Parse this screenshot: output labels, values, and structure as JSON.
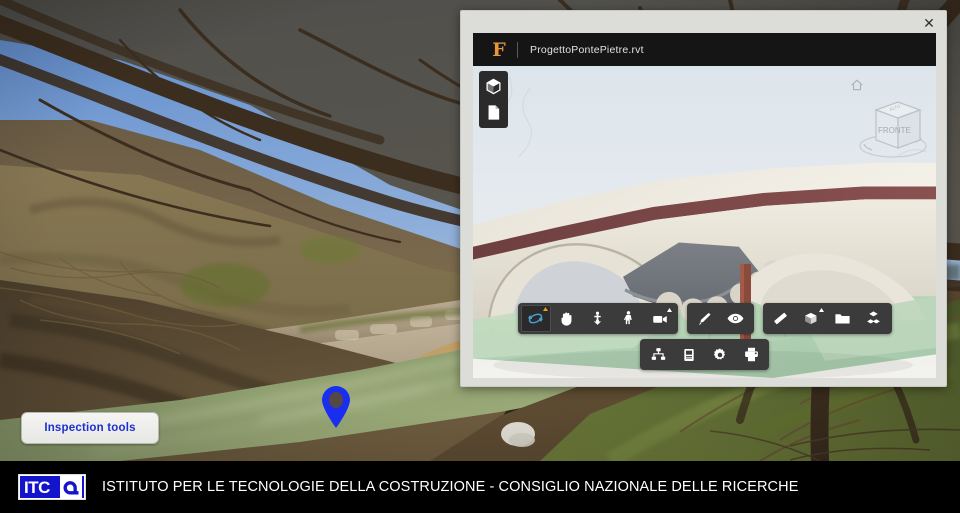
{
  "scene": {
    "description": "Photograph of a stone masonry arch bridge over a shallow green stream with bare winter tree branches",
    "marker_label": "inspection-point"
  },
  "overlay": {
    "inspection_button_label": "Inspection tools"
  },
  "viewer": {
    "close_label": "✕",
    "brand_letter": "F",
    "filename": "ProgettoPontePietre.rvt",
    "left_tools": [
      {
        "name": "model-browser-icon",
        "label": "Model browser"
      },
      {
        "name": "document-icon",
        "label": "Documents"
      }
    ],
    "navcube": {
      "front_label": "FRONTE",
      "top_label": "ALTO",
      "home_label": "Home"
    },
    "toolbars": [
      {
        "id": "navigation-group",
        "buttons": [
          {
            "name": "orbit-icon",
            "label": "Orbit",
            "active": true
          },
          {
            "name": "pan-hand-icon",
            "label": "Pan",
            "active": false
          },
          {
            "name": "zoom-anchor-icon",
            "label": "Zoom",
            "active": false
          },
          {
            "name": "walk-person-icon",
            "label": "First person walk",
            "active": false
          },
          {
            "name": "camera-icon",
            "label": "Camera interactions",
            "active": false
          }
        ]
      },
      {
        "id": "selection-group",
        "buttons": [
          {
            "name": "select-pointer-icon",
            "label": "Select",
            "active": false
          },
          {
            "name": "eye-visibility-icon",
            "label": "Show / hide",
            "active": false
          }
        ]
      },
      {
        "id": "tools-group",
        "buttons": [
          {
            "name": "measure-ruler-icon",
            "label": "Measure",
            "active": false
          },
          {
            "name": "section-box-icon",
            "label": "Section box",
            "active": false
          },
          {
            "name": "folder-icon",
            "label": "Folder",
            "active": false
          },
          {
            "name": "explode-model-icon",
            "label": "Explode",
            "active": false
          }
        ]
      },
      {
        "id": "panels-group",
        "buttons": [
          {
            "name": "model-tree-icon",
            "label": "Model tree",
            "active": false
          },
          {
            "name": "properties-panel-icon",
            "label": "Properties",
            "active": false
          },
          {
            "name": "settings-gear-icon",
            "label": "Settings",
            "active": false
          },
          {
            "name": "print-icon",
            "label": "Print",
            "active": false
          }
        ]
      }
    ]
  },
  "footer": {
    "logo_letters": "ITC",
    "text": "ISTITUTO PER LE TECNOLOGIE DELLA COSTRUZIONE - CONSIGLIO NAZIONALE DELLE RICERCHE"
  },
  "colors": {
    "accent_blue": "#1e2fd0",
    "marker_blue": "#1a2ef0",
    "brand_orange": "#e8963a",
    "footer_bg": "#000000",
    "toolbar_bg": "#3b3b3b",
    "titlebar_bg": "#151515",
    "logo_blue": "#1414cc"
  }
}
